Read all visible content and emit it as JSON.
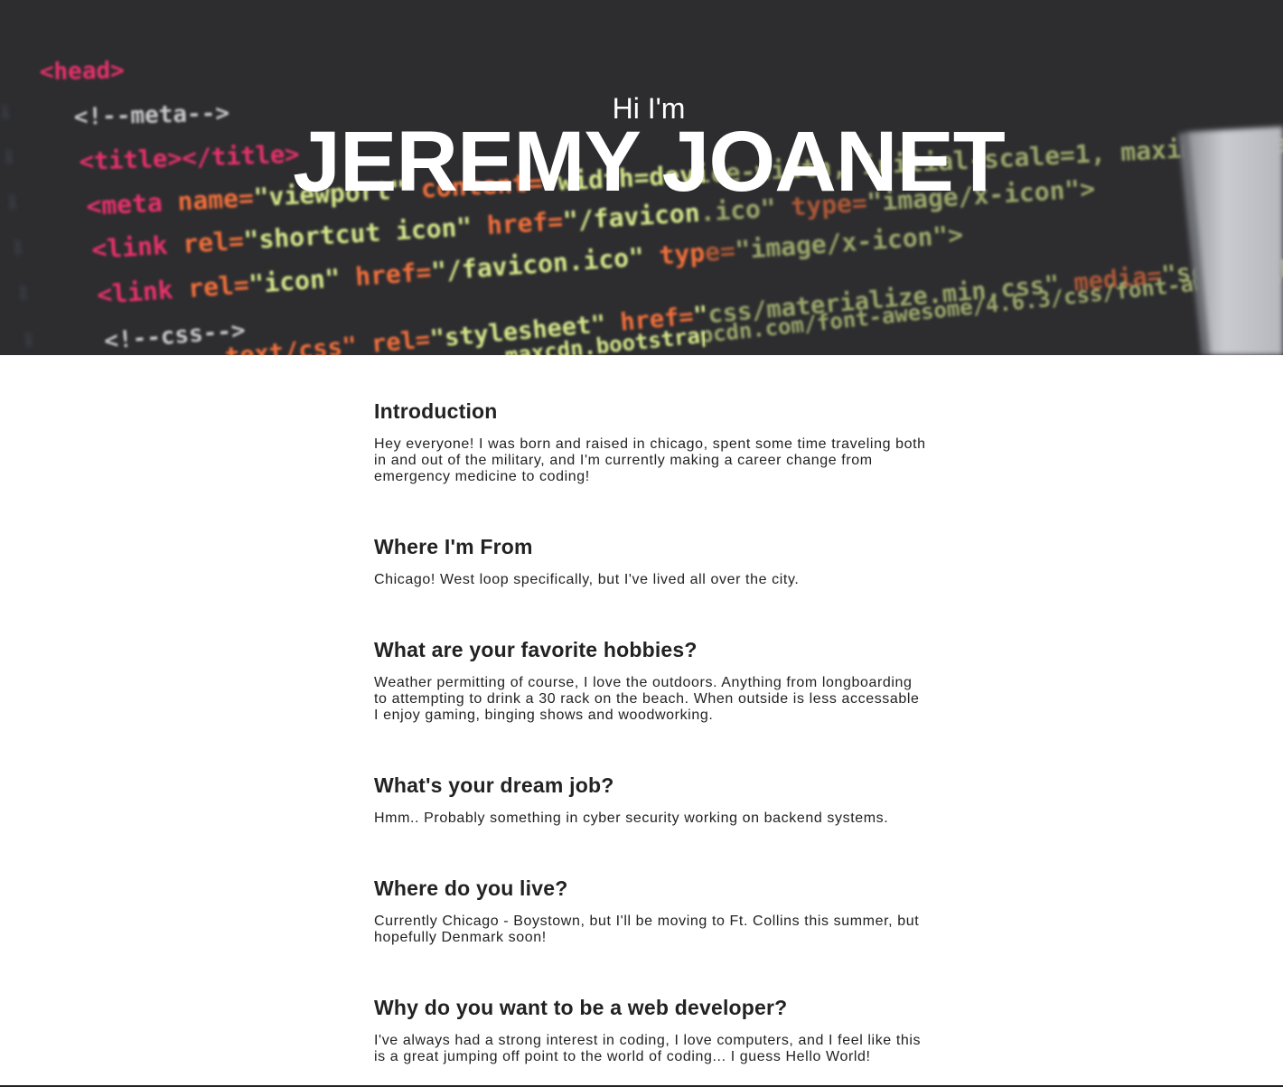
{
  "hero": {
    "greeting": "Hi I'm",
    "name": "JEREMY JOANET",
    "background_icon": "code-editor-background-image"
  },
  "sections": [
    {
      "heading": "Introduction",
      "body": "Hey everyone! I was born and raised in chicago, spent some time traveling both in and out of the military, and I'm currently making a career change from emergency medicine to coding!"
    },
    {
      "heading": "Where I'm From",
      "body": "Chicago! West loop specifically, but I've lived all over the city."
    },
    {
      "heading": "What are your favorite hobbies?",
      "body": "Weather permitting of course, I love the outdoors. Anything from longboarding to attempting to drink a 30 rack on the beach. When outside is less accessable I enjoy gaming, binging shows and woodworking."
    },
    {
      "heading": "What's your dream job?",
      "body": "Hmm.. Probably something in cyber security working on backend systems."
    },
    {
      "heading": "Where do you live?",
      "body": "Currently Chicago - Boystown, but I'll be moving to Ft. Collins this summer, but hopefully Denmark soon!"
    },
    {
      "heading": "Why do you want to be a web developer?",
      "body": "I've always had a strong interest in coding, I love computers, and I feel like this is a great jumping off point to the world of coding... I guess Hello World!"
    }
  ],
  "colors": {
    "hero_bg": "#2e2e31",
    "text": "#222222",
    "tag_red": "#e8336b",
    "attr_orange": "#f2703a",
    "string_green": "#d6e88a"
  }
}
